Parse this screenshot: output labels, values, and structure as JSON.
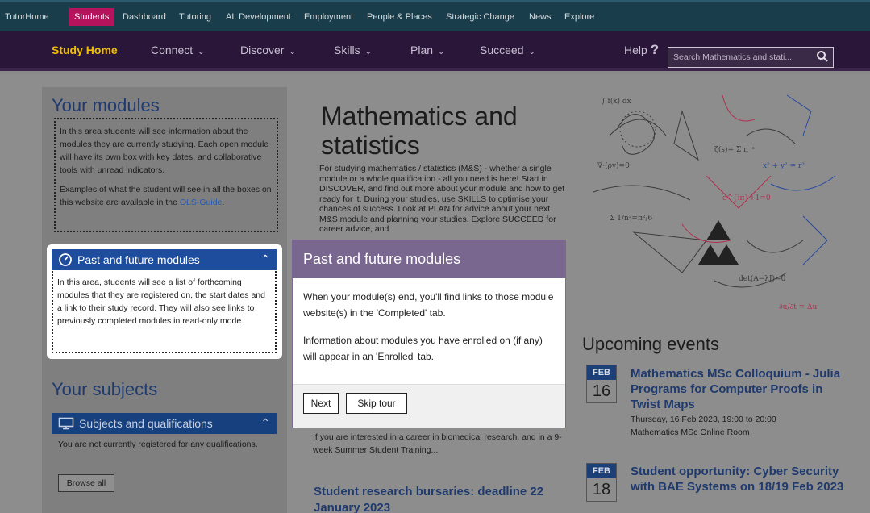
{
  "topnav": {
    "items": [
      {
        "label": "TutorHome"
      },
      {
        "label": "Students"
      },
      {
        "label": "Dashboard"
      },
      {
        "label": "Tutoring"
      },
      {
        "label": "AL Development"
      },
      {
        "label": "Employment"
      },
      {
        "label": "People & Places"
      },
      {
        "label": "Strategic Change"
      },
      {
        "label": "News"
      },
      {
        "label": "Explore"
      }
    ],
    "active": "Students"
  },
  "mainnav": {
    "items": [
      {
        "label": "Study Home"
      },
      {
        "label": "Connect"
      },
      {
        "label": "Discover"
      },
      {
        "label": "Skills"
      },
      {
        "label": "Plan"
      },
      {
        "label": "Succeed"
      }
    ],
    "help_label": "Help",
    "help_mark": "?",
    "search_placeholder": "Search Mathematics and stati..."
  },
  "modules": {
    "heading": "Your modules",
    "intro": "In this area students will see information about the modules they are currently studying. Each open module will have its own box with key dates, and collaborative tools with unread indicators.",
    "examples_prefix": "Examples of what the student will see in all the boxes on this website are available in the ",
    "examples_link": "OLS-Guide",
    "examples_suffix": ".",
    "past_future_title": "Past and future modules",
    "past_future_text": "In this area, students will see a list of forthcoming modules that they are registered on, the start dates and a link to their study record. They will also see links to previously completed modules in read-only mode."
  },
  "subjects": {
    "heading": "Your subjects",
    "panel_title": "Subjects and qualifications",
    "text": "You are not currently registered for any qualifications.",
    "browse_label": "Browse all"
  },
  "center": {
    "title": "Mathematics and statistics",
    "intro": "For studying mathematics / statistics (M&S) - whether a single module or a whole qualification - all you need is here! Start in DISCOVER, and find out more about your module and how to get ready for it.  During your studies, use SKILLS to optimise your chances of success.  Look at PLAN for advice about your next M&S module and planning your studies. Explore SUCCEED for career advice, and",
    "career_text": "If you are interested in a career in biomedical research, and in a 9-week Summer Student Training...",
    "bursary_title": "Student research bursaries: deadline 22 January 2023"
  },
  "popover": {
    "title": "Past and future modules",
    "para1": "When your module(s) end, you'll find links to those module website(s) in the 'Completed' tab.",
    "para2": "Information about modules you have enrolled on (if any) will appear in an 'Enrolled' tab.",
    "next_label": "Next",
    "skip_label": "Skip tour"
  },
  "events": {
    "heading": "Upcoming events",
    "items": [
      {
        "month": "FEB",
        "day": "16",
        "title": "Mathematics MSc Colloquium - Julia Programs for Computer Proofs in Twist Maps",
        "when": "Thursday, 16 Feb 2023, 19:00 to 20:00",
        "where": "Mathematics MSc Online Room"
      },
      {
        "month": "FEB",
        "day": "18",
        "title": "Student opportunity: Cyber Security with BAE Systems on 18/19 Feb 2023"
      }
    ]
  },
  "colors": {
    "topbar": "#1a3d4c",
    "active_tab": "#b5145d",
    "mainbar": "#2a1638",
    "study_home": "#f0c000",
    "heading_blue": "#1f3a6e",
    "panel_blue": "#1f4d9e",
    "popover_header": "#7a6790"
  }
}
